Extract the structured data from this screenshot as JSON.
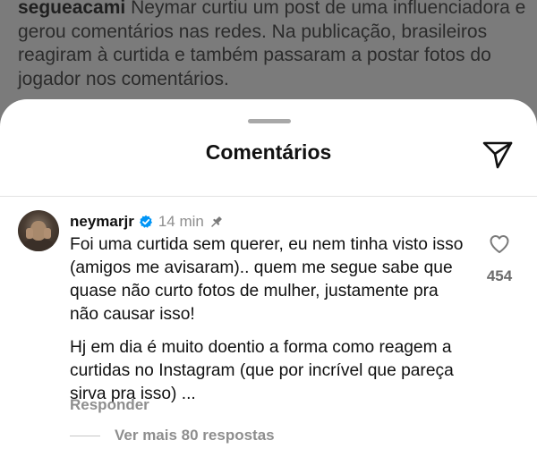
{
  "post": {
    "username": "segueacami",
    "caption": "Neymar curtiu um post de uma influenciadora e gerou comentários nas redes. Na publicação, brasileiros reagiram à curtida e também passaram a postar fotos do jogador nos comentários."
  },
  "sheet": {
    "title": "Comentários"
  },
  "comment": {
    "username": "neymarjr",
    "time": "14 min",
    "verified": true,
    "pinned": true,
    "text_paragraphs": [
      "Foi uma curtida sem querer, eu nem tinha visto isso (amigos me avisaram).. quem me segue sabe que quase não curto fotos de mulher, justamente pra não causar isso!",
      "Hj em dia é muito doentio a forma como reagem a curtidas no Instagram (que por incrível que pareça sirva pra isso) ..."
    ],
    "reply_label": "Responder",
    "like_count": "454",
    "more_replies_label": "Ver mais 80 respostas"
  },
  "icons": {
    "share": "send-icon",
    "like": "heart-icon",
    "verified": "verified-badge-icon",
    "pin": "pin-icon"
  },
  "colors": {
    "verified_blue": "#0095f6",
    "muted_text": "#8e8e8e"
  }
}
